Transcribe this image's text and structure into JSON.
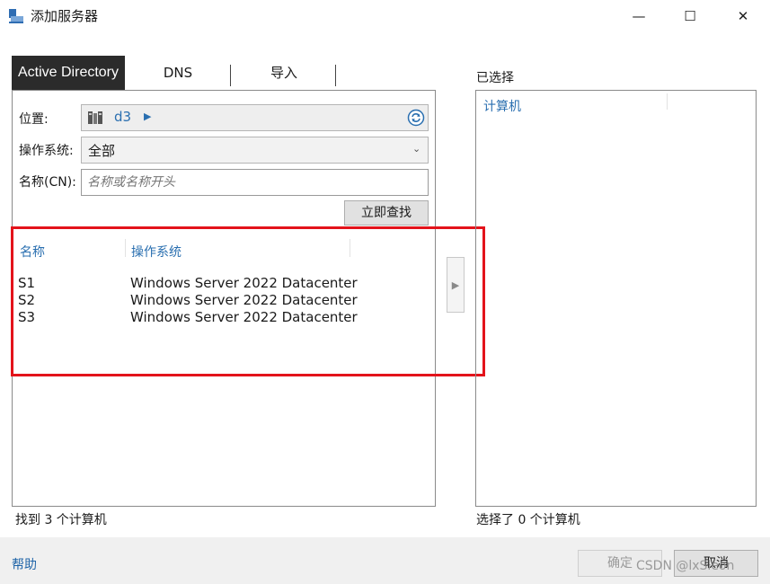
{
  "window": {
    "title": "添加服务器",
    "minimize_glyph": "—",
    "maximize_glyph": "☐",
    "close_glyph": "✕"
  },
  "tabs": [
    {
      "label": "Active Directory",
      "active": true
    },
    {
      "label": "DNS",
      "active": false
    },
    {
      "label": "导入",
      "active": false
    }
  ],
  "form": {
    "location_label": "位置:",
    "location_value": "d3",
    "os_label": "操作系统:",
    "os_value": "全部",
    "name_label": "名称(CN):",
    "name_placeholder": "名称或名称开头",
    "search_button": "立即查找"
  },
  "results": {
    "columns": [
      "名称",
      "操作系统"
    ],
    "rows": [
      {
        "name": "S1",
        "os": "Windows Server 2022 Datacenter"
      },
      {
        "name": "S2",
        "os": "Windows Server 2022 Datacenter"
      },
      {
        "name": "S3",
        "os": "Windows Server 2022 Datacenter"
      }
    ],
    "status": "找到 3 个计算机"
  },
  "selected": {
    "title": "已选择",
    "column": "计算机",
    "status": "选择了 0 个计算机"
  },
  "footer": {
    "help": "帮助",
    "ok": "确定",
    "cancel": "取消"
  },
  "watermark": "CSDN @lxSleon",
  "colors": {
    "accent": "#2a6fb0",
    "highlight_frame": "#e3131b",
    "active_tab": "#2b2b2b"
  }
}
